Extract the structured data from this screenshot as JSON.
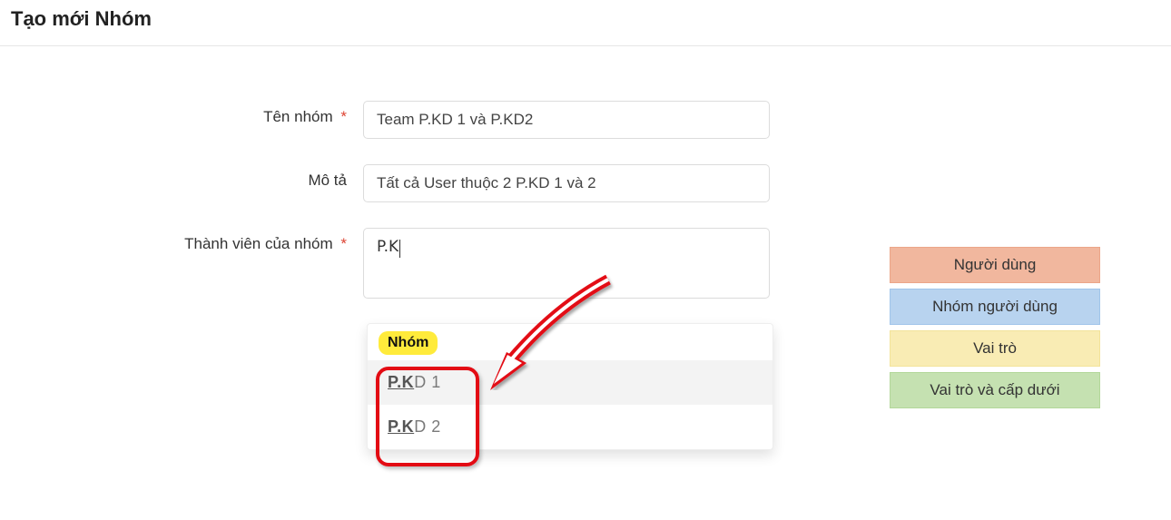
{
  "page": {
    "title": "Tạo mới Nhóm"
  },
  "form": {
    "group_name": {
      "label": "Tên nhóm",
      "value": "Team P.KD 1 và P.KD2",
      "required": true
    },
    "description": {
      "label": "Mô tả",
      "value": "Tất cả User thuộc 2 P.KD 1 và 2",
      "required": false
    },
    "members": {
      "label": "Thành viên của nhóm",
      "search": "P.K",
      "required": true
    }
  },
  "dropdown": {
    "group_header": "Nhóm",
    "match": "P.K",
    "items": [
      {
        "rest": "D 1",
        "hover": true
      },
      {
        "rest": "D 2",
        "hover": false
      }
    ]
  },
  "side": {
    "user": "Người dùng",
    "user_group": "Nhóm người dùng",
    "role": "Vai trò",
    "role_sub": "Vai trò và cấp dưới"
  },
  "required_mark": "*"
}
